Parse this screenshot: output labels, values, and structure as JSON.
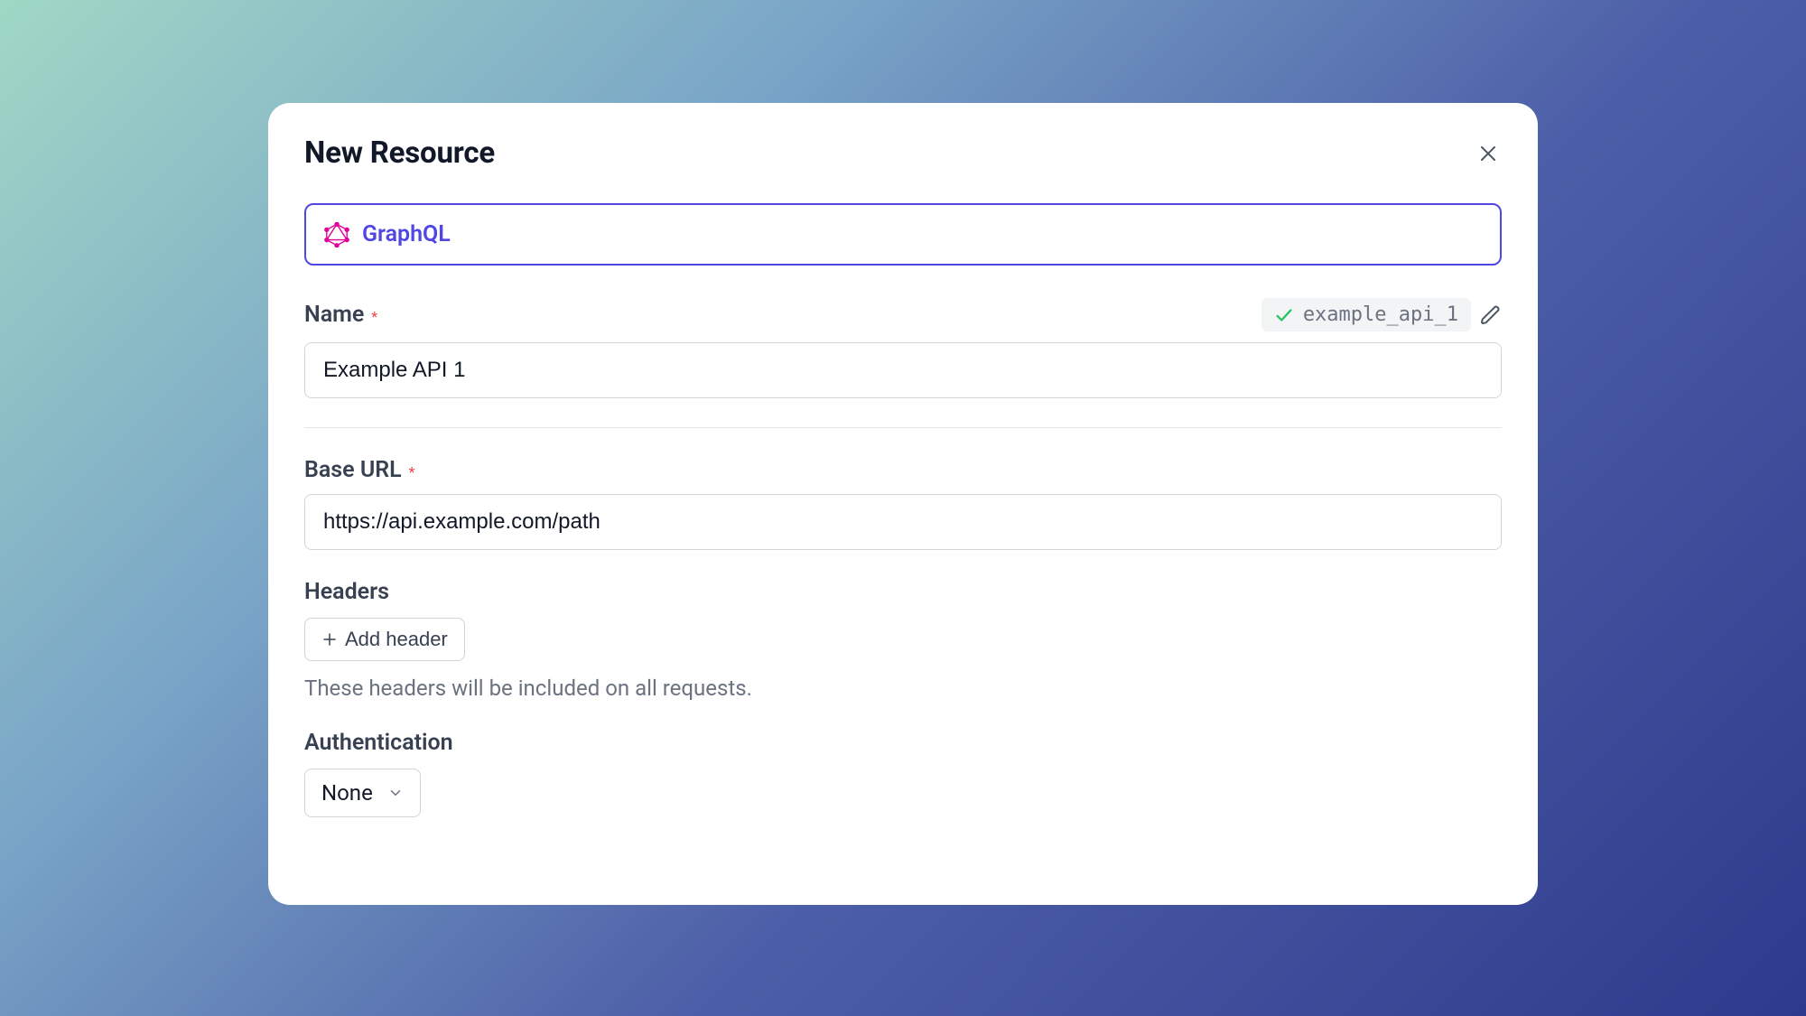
{
  "modal": {
    "title": "New Resource",
    "resource_type": {
      "label": "GraphQL",
      "icon": "graphql-icon"
    },
    "name": {
      "label": "Name",
      "required_marker": "*",
      "value": "Example API 1",
      "slug": "example_api_1"
    },
    "base_url": {
      "label": "Base URL",
      "required_marker": "*",
      "value": "https://api.example.com/path"
    },
    "headers": {
      "label": "Headers",
      "add_button": "Add header",
      "help_text": "These headers will be included on all requests."
    },
    "authentication": {
      "label": "Authentication",
      "selected": "None"
    }
  }
}
